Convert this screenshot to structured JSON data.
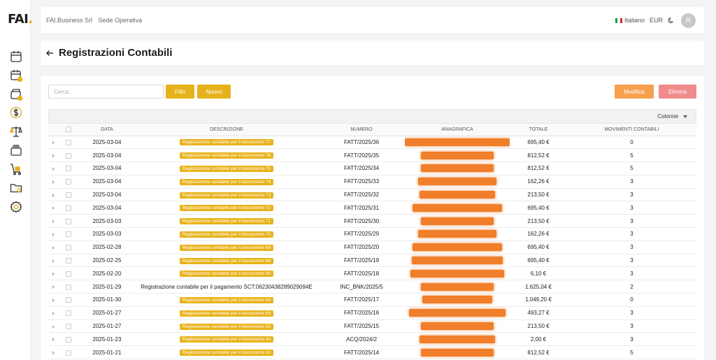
{
  "logo": {
    "text": "FAI",
    "dot": "."
  },
  "sidebar": {
    "items": [
      {
        "name": "calendar-icon"
      },
      {
        "name": "calendar-check-icon"
      },
      {
        "name": "wallet-icon"
      },
      {
        "name": "dollar-icon"
      },
      {
        "name": "scale-icon"
      },
      {
        "name": "card-stack-icon"
      },
      {
        "name": "cart-icon"
      },
      {
        "name": "folder-search-icon"
      },
      {
        "name": "gear-icon"
      }
    ]
  },
  "topbar": {
    "company": "FAI.Business Srl",
    "site": "Sede Operativa",
    "language": "Italiano",
    "currency": "EUR",
    "avatar_initial": "R"
  },
  "page": {
    "title": "Registrazioni Contabili"
  },
  "toolbar": {
    "search_placeholder": "Cerca...",
    "filtri": "Filtri",
    "nuovo": "Nuovo",
    "modifica": "Modifica",
    "elimina": "Elimina"
  },
  "table": {
    "columns_label": "Colonne",
    "headers": {
      "data": "DATA",
      "descrizione": "DESCRIZIONE",
      "numero": "NUMERO",
      "anagrafica": "ANAGRAFICA",
      "totale": "TOTALE",
      "movimenti": "MOVIMENTI CONTABILI"
    },
    "rows": [
      {
        "data": "2025-03-04",
        "descrizione": "Registrazione contabile per il documento 77",
        "badge": true,
        "numero": "FATT/2025/36",
        "totale": "695,40 €",
        "movimenti": "0"
      },
      {
        "data": "2025-03-04",
        "descrizione": "Registrazione contabile per il documento 76",
        "badge": true,
        "numero": "FATT/2025/35",
        "totale": "812,52 €",
        "movimenti": "5"
      },
      {
        "data": "2025-03-04",
        "descrizione": "Registrazione contabile per il documento 75",
        "badge": true,
        "numero": "FATT/2025/34",
        "totale": "812,52 €",
        "movimenti": "5"
      },
      {
        "data": "2025-03-04",
        "descrizione": "Registrazione contabile per il documento 74",
        "badge": true,
        "numero": "FATT/2025/33",
        "totale": "162,26 €",
        "movimenti": "3"
      },
      {
        "data": "2025-03-04",
        "descrizione": "Registrazione contabile per il documento 73",
        "badge": true,
        "numero": "FATT/2025/32",
        "totale": "213,50 €",
        "movimenti": "3"
      },
      {
        "data": "2025-03-04",
        "descrizione": "Registrazione contabile per il documento 72",
        "badge": true,
        "numero": "FATT/2025/31",
        "totale": "695,40 €",
        "movimenti": "3"
      },
      {
        "data": "2025-03-03",
        "descrizione": "Registrazione contabile per il documento 71",
        "badge": true,
        "numero": "FATT/2025/30",
        "totale": "213,50 €",
        "movimenti": "3"
      },
      {
        "data": "2025-03-03",
        "descrizione": "Registrazione contabile per il documento 70",
        "badge": true,
        "numero": "FATT/2025/29",
        "totale": "162,26 €",
        "movimenti": "3"
      },
      {
        "data": "2025-02-28",
        "descrizione": "Registrazione contabile per il documento 69",
        "badge": true,
        "numero": "FATT/2025/20",
        "totale": "695,40 €",
        "movimenti": "3"
      },
      {
        "data": "2025-02-25",
        "descrizione": "Registrazione contabile per il documento 68",
        "badge": true,
        "numero": "FATT/2025/19",
        "totale": "695,40 €",
        "movimenti": "3"
      },
      {
        "data": "2025-02-20",
        "descrizione": "Registrazione contabile per il documento 66",
        "badge": true,
        "numero": "FATT/2025/18",
        "totale": "6,10 €",
        "movimenti": "3"
      },
      {
        "data": "2025-01-29",
        "descrizione": "Registrazione contabile per il pagamento SCT:06230438289029094E",
        "badge": false,
        "numero": "INC_BNK/2025/5",
        "totale": "1.625,04 €",
        "movimenti": "2"
      },
      {
        "data": "2025-01-30",
        "descrizione": "Registrazione contabile per il documento 65",
        "badge": true,
        "numero": "FATT/2025/17",
        "totale": "1.049,20 €",
        "movimenti": "0"
      },
      {
        "data": "2025-01-27",
        "descrizione": "Registrazione contabile per il documento 63",
        "badge": true,
        "numero": "FATT/2025/16",
        "totale": "493,27 €",
        "movimenti": "3"
      },
      {
        "data": "2025-01-27",
        "descrizione": "Registrazione contabile per il documento 62",
        "badge": true,
        "numero": "FATT/2025/15",
        "totale": "213,50 €",
        "movimenti": "3"
      },
      {
        "data": "2025-01-23",
        "descrizione": "Registrazione contabile per il documento 42",
        "badge": true,
        "numero": "ACQ/2024/2",
        "totale": "2,00 €",
        "movimenti": "3"
      },
      {
        "data": "2025-01-21",
        "descrizione": "Registrazione contabile per il documento 61",
        "badge": true,
        "numero": "FATT/2025/14",
        "totale": "812,52 €",
        "movimenti": "5"
      }
    ]
  },
  "colors": {
    "accent": "#e5b21b",
    "modifica": "#f6a04d",
    "elimina": "#f08c8c",
    "redacted": "#f07e2a"
  }
}
